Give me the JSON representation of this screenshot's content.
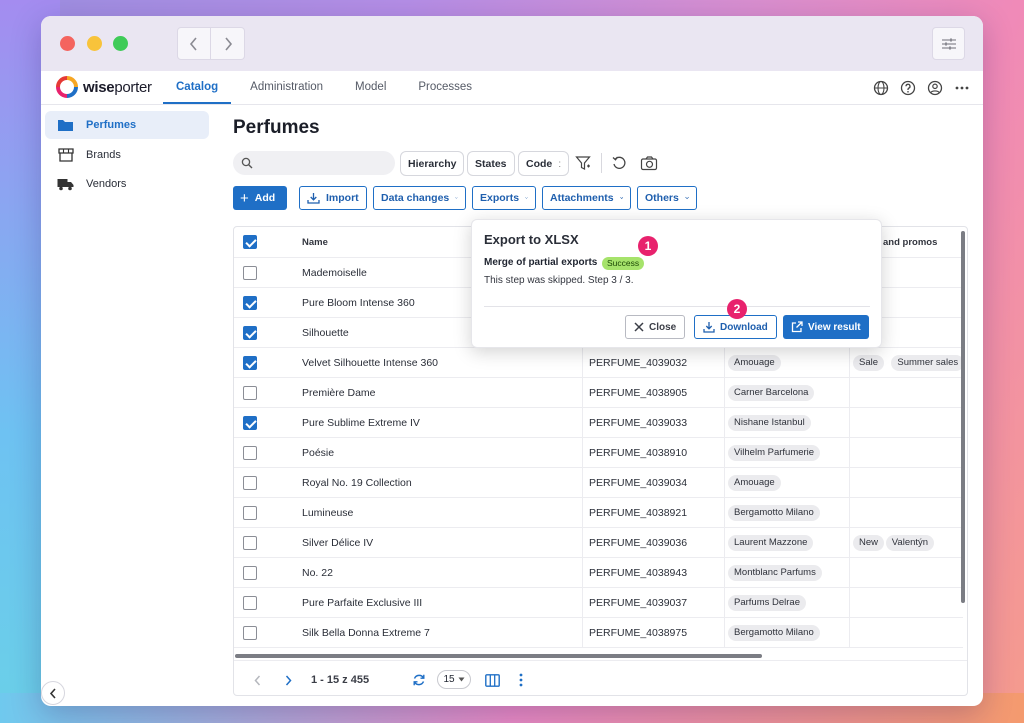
{
  "window": {
    "nav": {
      "back_icon": "chevron-left-icon",
      "forward_icon": "chevron-right-icon"
    },
    "settings_icon": "sliders-icon"
  },
  "brand": {
    "name_bold": "wise",
    "name_rest": "porter",
    "accent": "#1f6fc6"
  },
  "topnav": {
    "tabs": [
      {
        "label": "Catalog",
        "active": true
      },
      {
        "label": "Administration",
        "active": false
      },
      {
        "label": "Model",
        "active": false
      },
      {
        "label": "Processes",
        "active": false
      }
    ],
    "icons": [
      "globe-icon",
      "help-icon",
      "account-icon",
      "more-horizontal-icon"
    ]
  },
  "sidebar": {
    "items": [
      {
        "label": "Perfumes",
        "icon": "folder-icon",
        "active": true
      },
      {
        "label": "Brands",
        "icon": "store-icon",
        "active": false
      },
      {
        "label": "Vendors",
        "icon": "truck-icon",
        "active": false
      }
    ]
  },
  "main": {
    "title": "Perfumes",
    "search": {
      "placeholder": "",
      "value": ""
    },
    "filters": {
      "hierarchy": "Hierarchy",
      "states": "States",
      "code": "Code",
      "code_sub": ":"
    },
    "actions": {
      "add": "Add",
      "import": "Import",
      "data_changes": "Data changes",
      "exports": "Exports",
      "attachments": "Attachments",
      "others": "Others"
    },
    "table": {
      "columns": {
        "name": "Name",
        "promos": "and promos"
      },
      "rows": [
        {
          "checked": false,
          "name": "Mademoiselle",
          "code": "",
          "brand": "",
          "tags": []
        },
        {
          "checked": true,
          "name": "Pure Bloom Intense 360",
          "code": "",
          "brand": "",
          "tags": []
        },
        {
          "checked": true,
          "name": "Silhouette",
          "code": "",
          "brand": "",
          "tags": []
        },
        {
          "checked": true,
          "name": "Velvet Silhouette Intense 360",
          "code": "PERFUME_4039032",
          "brand": "Amouage",
          "tags": [
            "Sale",
            "Summer sales"
          ]
        },
        {
          "checked": false,
          "name": "Première Dame",
          "code": "PERFUME_4038905",
          "brand": "Carner Barcelona",
          "tags": []
        },
        {
          "checked": true,
          "name": "Pure Sublime Extreme IV",
          "code": "PERFUME_4039033",
          "brand": "Nishane Istanbul",
          "tags": []
        },
        {
          "checked": false,
          "name": "Poésie",
          "code": "PERFUME_4038910",
          "brand": "Vilhelm Parfumerie",
          "tags": []
        },
        {
          "checked": false,
          "name": "Royal No. 19 Collection",
          "code": "PERFUME_4039034",
          "brand": "Amouage",
          "tags": []
        },
        {
          "checked": false,
          "name": "Lumineuse",
          "code": "PERFUME_4038921",
          "brand": "Bergamotto Milano",
          "tags": []
        },
        {
          "checked": false,
          "name": "Silver Délice IV",
          "code": "PERFUME_4039036",
          "brand": "Laurent Mazzone",
          "tags": [
            "New",
            "Valentýn"
          ]
        },
        {
          "checked": false,
          "name": "No. 22",
          "code": "PERFUME_4038943",
          "brand": "Montblanc Parfums",
          "tags": []
        },
        {
          "checked": false,
          "name": "Pure Parfaite Exclusive III",
          "code": "PERFUME_4039037",
          "brand": "Parfums Delrae",
          "tags": []
        },
        {
          "checked": false,
          "name": "Silk Bella Donna Extreme 7",
          "code": "PERFUME_4038975",
          "brand": "Bergamotto Milano",
          "tags": []
        }
      ]
    },
    "pager": {
      "range": "1 - 15 z 455",
      "page_size": "15"
    }
  },
  "export_popup": {
    "title": "Export to XLSX",
    "step_name": "Merge of partial exports",
    "status": "Success",
    "message": "This step was skipped. Step 3 / 3.",
    "close": "Close",
    "download": "Download",
    "view_result": "View result",
    "badge_1": "1",
    "badge_2": "2",
    "badge_color": "#e8226d",
    "success_color": "#a6e36b"
  }
}
